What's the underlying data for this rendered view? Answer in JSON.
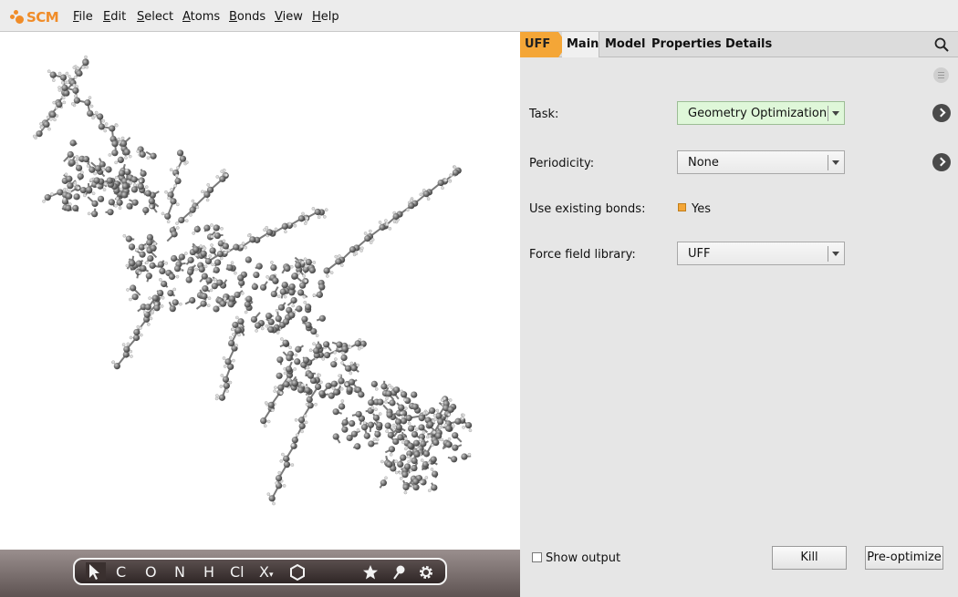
{
  "app": {
    "logo_text": "SCM",
    "brand_color": "#f08c28"
  },
  "menu": [
    "File",
    "Edit",
    "Select",
    "Atoms",
    "Bonds",
    "View",
    "Help"
  ],
  "menu_underline": [
    "F",
    "E",
    "S",
    "A",
    "B",
    "V",
    "H"
  ],
  "toolbar": {
    "tools": [
      "pointer-icon",
      "C",
      "O",
      "N",
      "H",
      "Cl",
      "X",
      "hexagon-icon",
      "star-icon",
      "pin-icon",
      "gear-icon"
    ]
  },
  "tabs": {
    "engine": "UFF",
    "main": "Main",
    "model": "Model",
    "properties": "Properties",
    "details": "Details"
  },
  "form": {
    "task_label": "Task:",
    "task_value": "Geometry Optimization",
    "periodicity_label": "Periodicity:",
    "periodicity_value": "None",
    "bonds_label": "Use existing bonds:",
    "bonds_value": "Yes",
    "ff_label": "Force field library:",
    "ff_value": "UFF"
  },
  "footer": {
    "show_output": "Show output",
    "kill": "Kill",
    "preoptimize": "Pre-optimize"
  },
  "colors": {
    "accent": "#f4a637",
    "task_bg": "#dff7d9",
    "viewer_bg": "#ffffff"
  }
}
